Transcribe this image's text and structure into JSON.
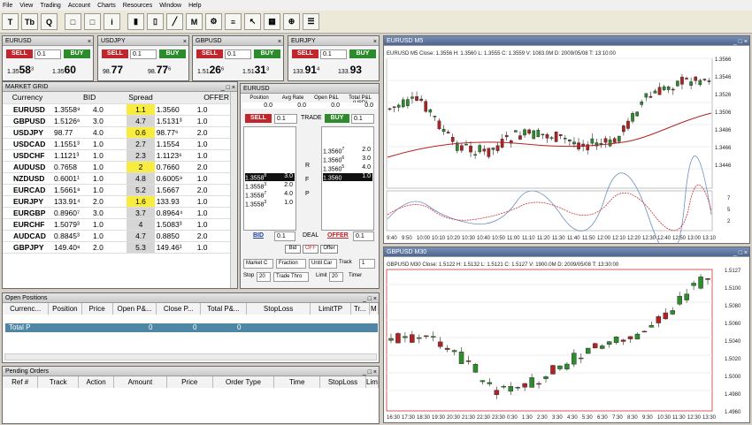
{
  "menu": [
    "File",
    "View",
    "Trading",
    "Account",
    "Charts",
    "Resources",
    "Window",
    "Help"
  ],
  "toolbar_icons": [
    "crosshair-icon",
    "trade-icon",
    "quote-icon",
    "window-icon",
    "window-icon-2",
    "info-icon",
    "bar-chart-icon",
    "candle-chart-icon",
    "line-chart-icon",
    "m5-icon",
    "chart-settings-icon",
    "layers-icon",
    "cursor-icon",
    "grid-icon",
    "zoom-icon",
    "list-icon"
  ],
  "tickets": [
    {
      "sym": "EURUSD",
      "sell": "SELL",
      "qty": "0.1",
      "buy": "BUY",
      "bid_small": "1.35",
      "bid_big": "58",
      "bid_sup": "3",
      "ask_small": "1.35",
      "ask_big": "60"
    },
    {
      "sym": "USDJPY",
      "sell": "SELL",
      "qty": "0.1",
      "buy": "BUY",
      "bid_small": "98.",
      "bid_big": "77",
      "bid_sup": "",
      "ask_small": "98.",
      "ask_big": "77",
      "ask_sup": "6"
    },
    {
      "sym": "GBPUSD",
      "sell": "SELL",
      "qty": "0.1",
      "buy": "BUY",
      "bid_small": "1.51",
      "bid_big": "26",
      "bid_sup": "6",
      "ask_small": "1.51",
      "ask_big": "31",
      "ask_sup": "3"
    },
    {
      "sym": "EURJPY",
      "sell": "SELL",
      "qty": "0.1",
      "buy": "BUY",
      "bid_small": "133.",
      "bid_big": "91",
      "bid_sup": "4",
      "ask_small": "133.",
      "ask_big": "93"
    }
  ],
  "market_grid": {
    "title": "MARKET GRID",
    "headers": [
      "Currency",
      "BID",
      "Spread",
      "OFFER"
    ],
    "rows": [
      [
        "EURUSD",
        "1.3558⁹",
        "4.0",
        "1.1",
        "1.3560",
        "1.0",
        "y"
      ],
      [
        "GBPUSD",
        "1.5126⁶",
        "3.0",
        "4.7",
        "1.5131³",
        "1.0",
        "n"
      ],
      [
        "USDJPY",
        "98.77",
        "4.0",
        "0.6",
        "98.77⁶",
        "2.0",
        "y"
      ],
      [
        "USDCAD",
        "1.1551³",
        "1.0",
        "2.7",
        "1.1554",
        "1.0",
        "n"
      ],
      [
        "USDCHF",
        "1.1121³",
        "1.0",
        "2.3",
        "1.1123⁶",
        "1.0",
        "n"
      ],
      [
        "AUDUSD",
        "0.7658",
        "1.0",
        "2",
        "0.7660",
        "2.0",
        "y"
      ],
      [
        "NZDUSD",
        "0.6001¹",
        "1.0",
        "4.8",
        "0.6005⁹",
        "1.0",
        "n"
      ],
      [
        "EURCAD",
        "1.5661⁸",
        "1.0",
        "5.2",
        "1.5667",
        "2.0",
        "n"
      ],
      [
        "EURJPY",
        "133.91⁴",
        "2.0",
        "1.6",
        "133.93",
        "1.0",
        "y"
      ],
      [
        "EURGBP",
        "0.8960⁷",
        "3.0",
        "3.7",
        "0.8964⁴",
        "1.0",
        "n"
      ],
      [
        "EURCHF",
        "1.5079³",
        "1.0",
        "4",
        "1.5083³",
        "1.0",
        "n"
      ],
      [
        "AUDCAD",
        "0.8845³",
        "1.0",
        "4.7",
        "0.8850",
        "2.0",
        "n"
      ],
      [
        "GBPJPY",
        "149.40⁸",
        "2.0",
        "5.3",
        "149.46¹",
        "1.0",
        "n"
      ]
    ]
  },
  "depth": {
    "title": "EURUSD",
    "cols": [
      "Position",
      "Avg Rate",
      "Open P&L",
      "Total P&L (USD)"
    ],
    "vals": [
      "0.0",
      "0.0",
      "0.0",
      "0.0"
    ],
    "sell": "SELL",
    "qty": "0.1",
    "trade": "TRADE",
    "buy": "BUY",
    "buyqty": "0.1",
    "letters": [
      "R",
      "F",
      "P"
    ],
    "bids": [
      [
        "1.3558",
        "8",
        "3.0"
      ],
      [
        "1.3558",
        "3",
        "2.0"
      ],
      [
        "1.3558",
        "7",
        "4.0"
      ],
      [
        "1.3558",
        "3",
        "1.0"
      ]
    ],
    "asks": [
      [
        "1.3560",
        "7",
        "2.0"
      ],
      [
        "1.3560",
        "6",
        "3.0"
      ],
      [
        "1.3560",
        "5",
        "4.0"
      ],
      [
        "1.3560",
        "",
        "1.0"
      ]
    ],
    "bid_lbl": "BID",
    "deal": "DEAL",
    "offer": "OFFER",
    "bid_btn": "Bid",
    "off_btn": "OFF",
    "offer_btn": "Offer",
    "market": "Market C",
    "fraction": "Fraction",
    "until": "Until Car",
    "track": "Track",
    "track_val": "1",
    "stop": "Stop",
    "stop_val": "20",
    "trade_thr": "Trade Thro",
    "limit": "Limit",
    "limit_val": "20",
    "timer": "Timer"
  },
  "open_positions": {
    "title": "Open Positions",
    "cols": [
      "Currenc...",
      "Position",
      "Price",
      "Open P&...",
      "Close P...",
      "Total P&...",
      "StopLoss",
      "LimitTP",
      "Tr...",
      "M"
    ],
    "total": "Total P",
    "zeros": [
      "0",
      "0",
      "0"
    ]
  },
  "pending_orders": {
    "title": "Pending Orders",
    "cols": [
      "Ref #",
      "Track",
      "Action",
      "Amount",
      "Price",
      "Order Type",
      "Time",
      "StopLoss",
      "Lim"
    ]
  },
  "chart1": {
    "title": "EURUSD M5",
    "info": "EURUSD M5 Close: 1.3556 H: 1.3560 L: 1.3555 C: 1.3559 V: 1083.0M D: 2009/05/08 T: 13:10:00",
    "stoch": "Sto(5,3,3) 70.485",
    "xticks": [
      "9:40",
      "9:50",
      "10:00",
      "10:10",
      "10:20",
      "10:30",
      "10:40",
      "10:50",
      "11:00",
      "11:10",
      "11:20",
      "11:30",
      "11:40",
      "11:50",
      "12:00",
      "12:10",
      "12:20",
      "12:30",
      "12:40",
      "12:50",
      "13:00",
      "13:10"
    ],
    "yticks": [
      "1.3566",
      "1.3546",
      "1.3526",
      "1.3506",
      "1.3486",
      "1.3466",
      "1.3446"
    ],
    "stoch_ticks": [
      "7",
      "5",
      "2"
    ]
  },
  "chart2": {
    "title": "GBPUSD M30",
    "info": "GBPUSD M30 Close: 1.5122 H: 1.5132 L: 1.5121 C: 1.5127 V: 1900.0M D: 2009/05/08 T: 13:30:00",
    "xticks": [
      "16:30",
      "17:30",
      "18:30",
      "19:30",
      "20:30",
      "21:30",
      "22:30",
      "23:30",
      "0:30",
      "1:30",
      "2:30",
      "3:30",
      "4:30",
      "5:30",
      "6:30",
      "7:30",
      "8:30",
      "9:30",
      "10:30",
      "11:30",
      "12:30",
      "13:30"
    ],
    "yticks": [
      "1.5127",
      "1.5100",
      "1.5080",
      "1.5060",
      "1.5040",
      "1.5020",
      "1.5000",
      "1.4980",
      "1.4960"
    ]
  },
  "colors": {
    "up": "#2e8b2e",
    "down": "#b22222",
    "ma": "#b22222",
    "accent": "#c0262c"
  }
}
